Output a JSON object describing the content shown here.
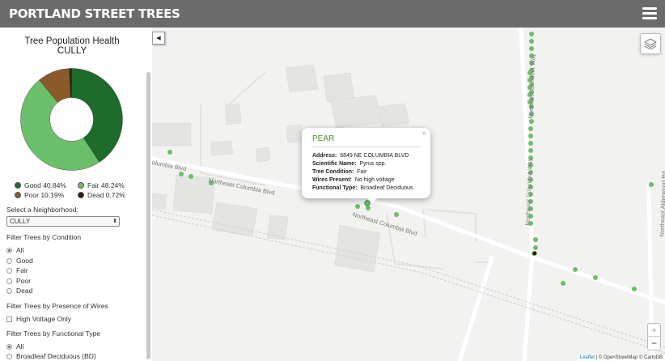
{
  "header": {
    "title": "PORTLAND STREET TREES",
    "menu_icon": "hamburger-icon"
  },
  "sidebar": {
    "chart_title": "Tree Population Health",
    "neighborhood_heading": "CULLY",
    "select_label": "Select a Neighborhood:",
    "select_value": "CULLY",
    "condition_heading": "Filter Trees by Condition",
    "condition_options": [
      "All",
      "Good",
      "Fair",
      "Poor",
      "Dead"
    ],
    "condition_selected": "All",
    "wires_heading": "Filter Trees by Presence of Wires",
    "wires_option": "High Voltage Only",
    "type_heading": "Filter Trees by Functional Type",
    "type_options": [
      "All",
      "Broadleaf Deciduous (BD)"
    ],
    "type_selected": "All",
    "legend": [
      {
        "label": "Good 40.84%",
        "color": "#1e6b2b"
      },
      {
        "label": "Fair 48.24%",
        "color": "#6cbf6a"
      },
      {
        "label": "Poor 10.19%",
        "color": "#8a5a2b"
      },
      {
        "label": "Dead 0.72%",
        "color": "#2b1d10"
      }
    ]
  },
  "chart_data": {
    "type": "pie",
    "title": "Tree Population Health",
    "subtitle": "CULLY",
    "categories": [
      "Good",
      "Fair",
      "Poor",
      "Dead"
    ],
    "values": [
      40.84,
      48.24,
      10.19,
      0.72
    ],
    "colors": [
      "#1e6b2b",
      "#6cbf6a",
      "#8a5a2b",
      "#2b1d10"
    ],
    "legend": "bottom"
  },
  "map": {
    "streets": {
      "columbia_blvd_1": "Northeast Columbia Blvd",
      "columbia_blvd_2": "Northeast Columbia Blvd",
      "columbia_left": "olumbia Blvd",
      "cornfoot": "Northeast Cornfoot Way",
      "columbia_way": "Northeast Columbia Way",
      "alderwood": "Northeast Alderwood Rd"
    },
    "popup": {
      "title": "PEAR",
      "close": "×",
      "address_label": "Address:",
      "address": "6849 NE COLUMBIA BLVD",
      "sci_label": "Scientific Name:",
      "sci": "Pyrus spp.",
      "cond_label": "Tree Condition:",
      "cond": "Fair",
      "wires_label": "Wires Present:",
      "wires": "No high voltage",
      "type_label": "Functional Type:",
      "type": "Broadleaf Deciduous"
    },
    "zoom_in": "+",
    "zoom_out": "−",
    "attribution_leaflet": "Leaflet",
    "attribution_rest": " | © OpenStreetMap © CartoDB",
    "collapse_icon": "◀",
    "tree_color": "#6cbf6a"
  }
}
